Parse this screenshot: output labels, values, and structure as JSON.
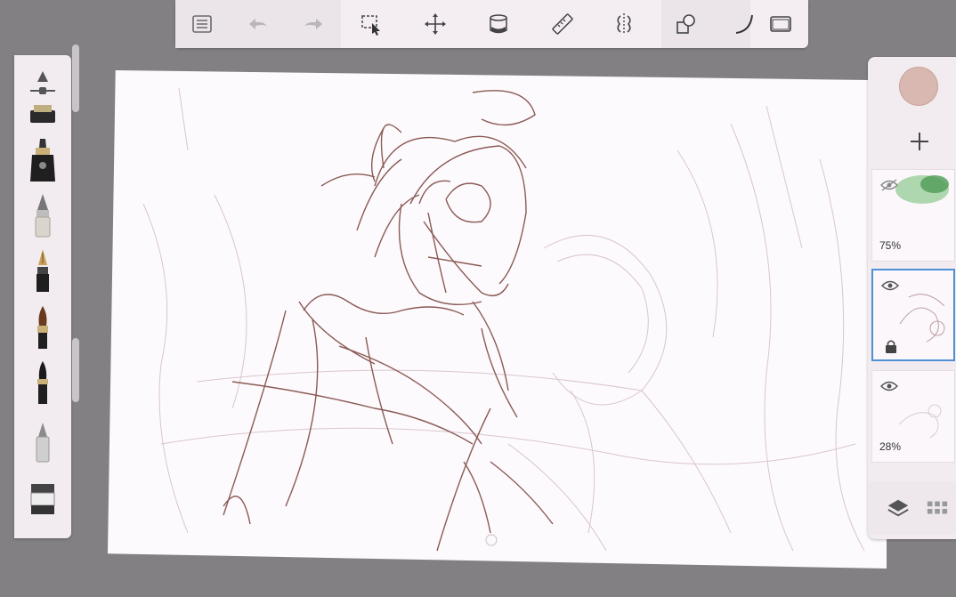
{
  "toolbar": {
    "tools": [
      {
        "name": "list-menu-icon"
      },
      {
        "name": "undo-icon"
      },
      {
        "name": "redo-icon"
      },
      {
        "name": "selection-icon"
      },
      {
        "name": "transform-move-icon"
      },
      {
        "name": "fill-bucket-icon"
      },
      {
        "name": "ruler-icon"
      },
      {
        "name": "symmetry-icon"
      },
      {
        "name": "shapes-icon"
      },
      {
        "name": "curve-icon"
      },
      {
        "name": "fullscreen-icon"
      }
    ]
  },
  "brushes": [
    {
      "name": "brush-size-slider-icon"
    },
    {
      "name": "marker-brush-icon"
    },
    {
      "name": "ink-pen-icon"
    },
    {
      "name": "pencil-brush-icon"
    },
    {
      "name": "fountain-pen-icon"
    },
    {
      "name": "paint-brush-icon"
    },
    {
      "name": "ink-brush-icon"
    },
    {
      "name": "airbrush-icon"
    },
    {
      "name": "eraser-icon"
    }
  ],
  "colors": {
    "current_color": "#d8b8b0",
    "selected_layer_border": "#4f8fd6",
    "sketch_stroke": "#8a5a55"
  },
  "layers": [
    {
      "opacity": "75%",
      "visible": false,
      "locked": false,
      "selected": false
    },
    {
      "opacity": "",
      "visible": true,
      "locked": true,
      "selected": true
    },
    {
      "opacity": "28%",
      "visible": true,
      "locked": false,
      "selected": false
    }
  ]
}
